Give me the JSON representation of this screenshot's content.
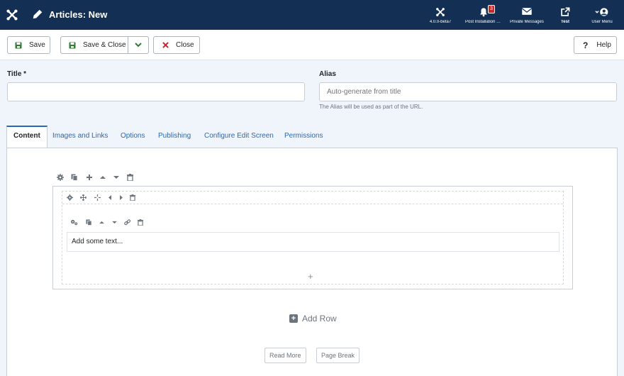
{
  "header": {
    "title": "Articles: New",
    "items": [
      {
        "label": "4.0.0-beta7",
        "icon": "joomla-icon"
      },
      {
        "label": "Post Installation Messages",
        "icon": "bell-icon",
        "badge": "3"
      },
      {
        "label": "Private Messages",
        "icon": "envelope-icon"
      },
      {
        "label": "Test",
        "icon": "external-link-icon"
      },
      {
        "label": "User Menu",
        "icon": "user-circle-icon"
      }
    ]
  },
  "toolbar": {
    "save": "Save",
    "save_close": "Save & Close",
    "close": "Close",
    "help": "Help"
  },
  "form": {
    "title_label": "Title *",
    "title_value": "",
    "alias_label": "Alias",
    "alias_placeholder": "Auto-generate from title",
    "alias_hint": "The Alias will be used as part of the URL."
  },
  "tabs": [
    "Content",
    "Images and Links",
    "Options",
    "Publishing",
    "Configure Edit Screen",
    "Permissions"
  ],
  "editor": {
    "text_placeholder": "Add some text...",
    "add_column": "+",
    "add_row": "Add Row",
    "read_more": "Read More",
    "page_break": "Page Break"
  },
  "colors": {
    "header_bg": "#132f53",
    "accent": "#2a69b8",
    "save_green": "#2f7d32",
    "close_red": "#c52827"
  }
}
